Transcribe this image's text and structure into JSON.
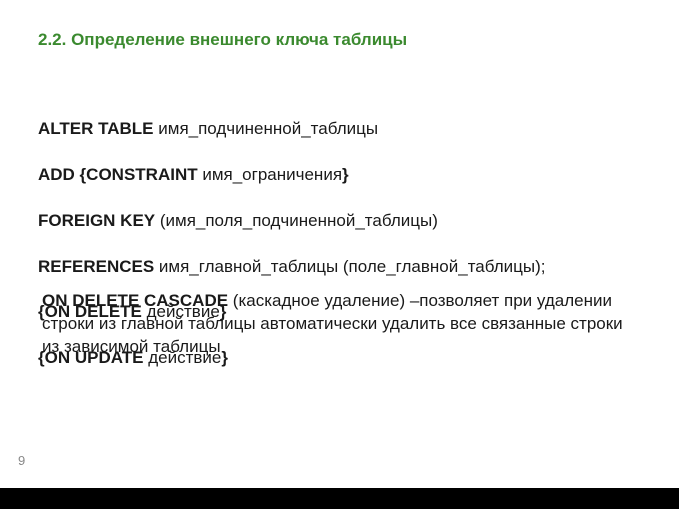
{
  "title": "2.2. Определение внешнего ключа таблицы",
  "code": {
    "l1a": "ALTER TABLE",
    "l1b": " имя_подчиненной_таблицы",
    "l2a": "ADD {CONSTRAINT",
    "l2b": " имя_ограничения",
    "l2c": "}",
    "l3a": "FOREIGN KEY",
    "l3b": " (имя_поля_подчиненной_таблицы)",
    "l4a": "REFERENCES",
    "l4b": " имя_главной_таблицы (поле_главной_таблицы);",
    "l5a": "{ON DELETE",
    "l5b": " действие",
    "l5c": "}",
    "l6a": "{ON UPDATE",
    "l6b": " действие",
    "l6c": "}"
  },
  "desc": {
    "bold": "ON DELETE CASCADE",
    "rest": " (каскадное удаление) –позволяет при удалении строки из главной таблицы автоматически удалить все связанные строки из зависимой таблицы"
  },
  "page": "9"
}
